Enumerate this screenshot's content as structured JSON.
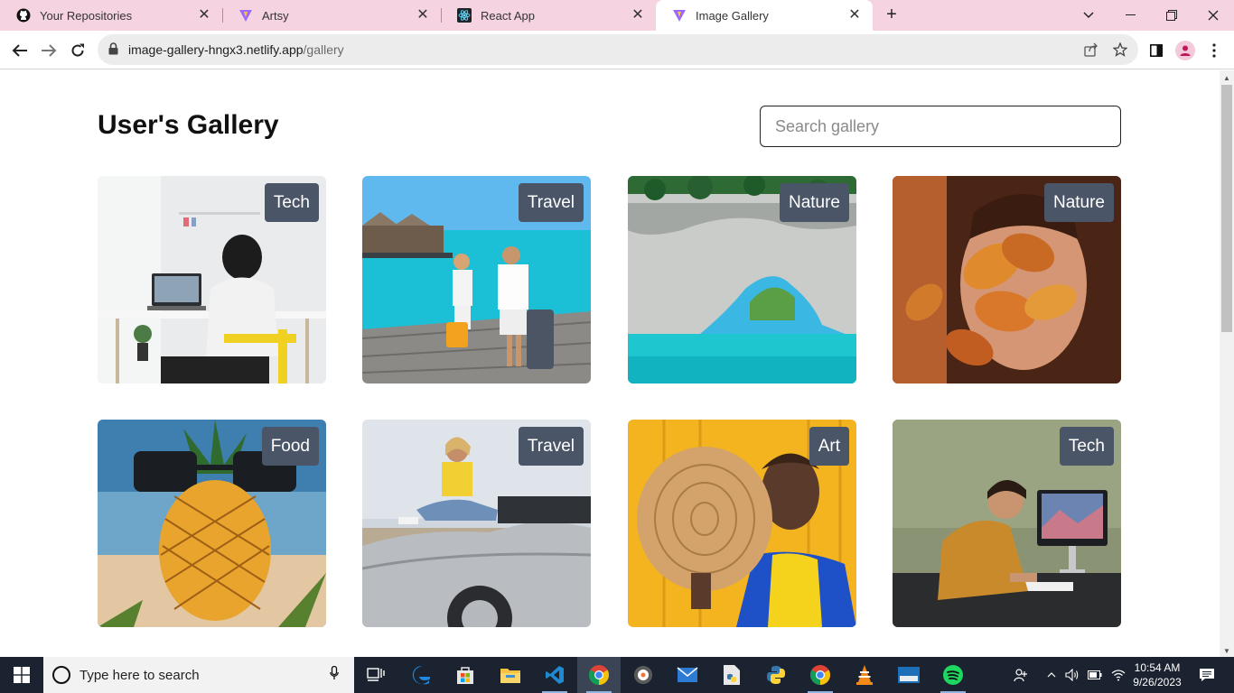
{
  "browser": {
    "tabs": [
      {
        "title": "Your Repositories",
        "icon": "github-icon",
        "active": false
      },
      {
        "title": "Artsy",
        "icon": "vite-icon",
        "active": false
      },
      {
        "title": "React App",
        "icon": "react-icon",
        "active": false
      },
      {
        "title": "Image Gallery",
        "icon": "vite-icon",
        "active": true
      }
    ],
    "url_host": "image-gallery-hngx3.netlify.app",
    "url_path": "/gallery"
  },
  "page": {
    "heading": "User's Gallery",
    "search_placeholder": "Search gallery",
    "cards": [
      {
        "tag": "Tech",
        "image": "person-at-laptop-desk"
      },
      {
        "tag": "Travel",
        "image": "couple-with-luggage-on-pier"
      },
      {
        "tag": "Nature",
        "image": "rock-arch-over-turquoise-sea"
      },
      {
        "tag": "Nature",
        "image": "woman-behind-autumn-leaves"
      },
      {
        "tag": "Food",
        "image": "pineapple-with-sunglasses-on-beach"
      },
      {
        "tag": "Travel",
        "image": "woman-sitting-on-convertible"
      },
      {
        "tag": "Art",
        "image": "woman-with-straw-hat-yellow-background"
      },
      {
        "tag": "Tech",
        "image": "man-writing-at-desk-with-imac"
      }
    ],
    "badge_color": "#4a5567"
  },
  "taskbar": {
    "search_placeholder": "Type here to search",
    "time": "10:54 AM",
    "date": "9/26/2023"
  }
}
